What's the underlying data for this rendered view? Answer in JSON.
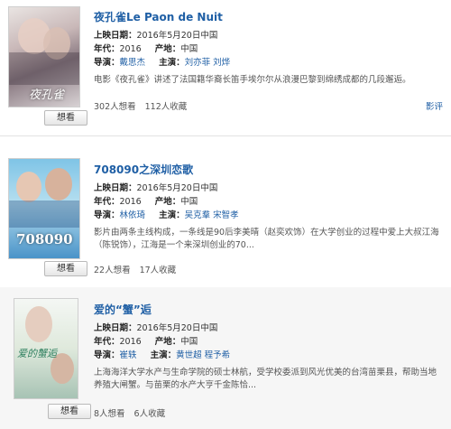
{
  "movies": [
    {
      "title": "夜孔雀Le Paon de Nuit",
      "poster_text": "夜孔雀",
      "release_label": "上映日期：",
      "release": "2016年5月20日中国",
      "year_label": "年代：",
      "year": "2016",
      "region_label": "产地：",
      "region": "中国",
      "director_label": "导演：",
      "director": "戴思杰",
      "cast_label": "主演：",
      "cast": [
        "刘亦菲",
        "刘烨"
      ],
      "description": "电影《夜孔雀》讲述了法国籍华裔长笛手埃尔尔从浪漫巴黎到绵绣成都的几段邂逅。",
      "want_count": "302人想看",
      "fav_count": "112人收藏",
      "want_button": "想看",
      "review_link": "影评"
    },
    {
      "title": "708090之深圳恋歌",
      "poster_text": "708090",
      "release_label": "上映日期：",
      "release": "2016年5月20日中国",
      "year_label": "年代：",
      "year": "2016",
      "region_label": "产地：",
      "region": "中国",
      "director_label": "导演：",
      "director": "林依琦",
      "cast_label": "主演：",
      "cast": [
        "吴克羣",
        "宋智孝"
      ],
      "description": "影片由两条主线构成，一条线是90后李美晴（赵奕欢饰）在大学创业的过程中爱上大叔江海（陈锐饰），江海是一个来深圳创业的70...",
      "want_count": "22人想看",
      "fav_count": "17人收藏",
      "want_button": "想看"
    },
    {
      "title": "爱的“蟹”逅",
      "poster_text": "爱的蟹逅",
      "release_label": "上映日期：",
      "release": "2016年5月20日中国",
      "year_label": "年代：",
      "year": "2016",
      "region_label": "产地：",
      "region": "中国",
      "director_label": "导演：",
      "director": "崔轶",
      "cast_label": "主演：",
      "cast": [
        "黄世超",
        "程予希"
      ],
      "description": "上海海洋大学水产与生命学院的硕士林航，受学校委派到风光优美的台湾苗栗县，帮助当地养殖大闸蟹。与苗栗的水产大亨千金陈恰...",
      "want_count": "8人想看",
      "fav_count": "6人收藏",
      "want_button": "想看"
    }
  ]
}
